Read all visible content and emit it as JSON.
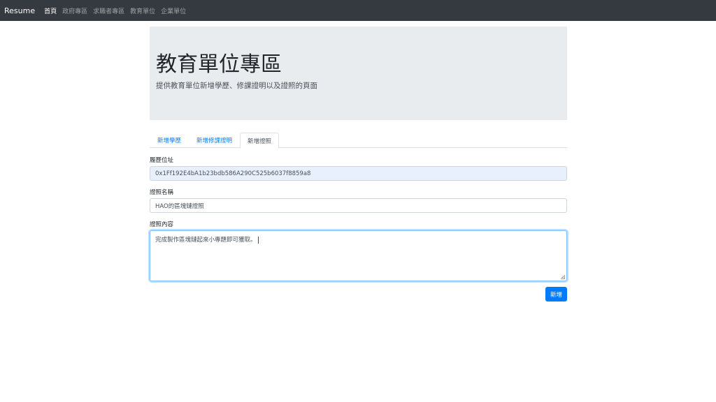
{
  "navbar": {
    "brand": "Resume",
    "links": [
      {
        "label": "首頁",
        "active": true
      },
      {
        "label": "政府專區",
        "active": false
      },
      {
        "label": "求職者專區",
        "active": false
      },
      {
        "label": "教育單位",
        "active": false
      },
      {
        "label": "企業單位",
        "active": false
      }
    ],
    "background": "#343a40"
  },
  "jumbotron": {
    "title": "教育單位專區",
    "lead": "提供教育單位新增學歷、修課證明以及證照的頁面"
  },
  "tabs": [
    {
      "label": "新增學歷",
      "active": false
    },
    {
      "label": "新增修課證明",
      "active": false
    },
    {
      "label": "新增證照",
      "active": true
    }
  ],
  "form": {
    "address": {
      "label": "履歷位址",
      "value": "0x1Ff192E4bA1b23bdb586A290C525b6037f8859a8"
    },
    "cert_name": {
      "label": "證照名稱",
      "value": "HAO的區塊鏈證照"
    },
    "cert_content": {
      "label": "證照內容",
      "value": "完成製作區塊鏈起來小專題即可獲取。"
    },
    "submit_label": "新增"
  },
  "colors": {
    "primary": "#007bff",
    "jumbotron_bg": "#e9ecef",
    "autofill_bg": "#e8f0fe"
  }
}
